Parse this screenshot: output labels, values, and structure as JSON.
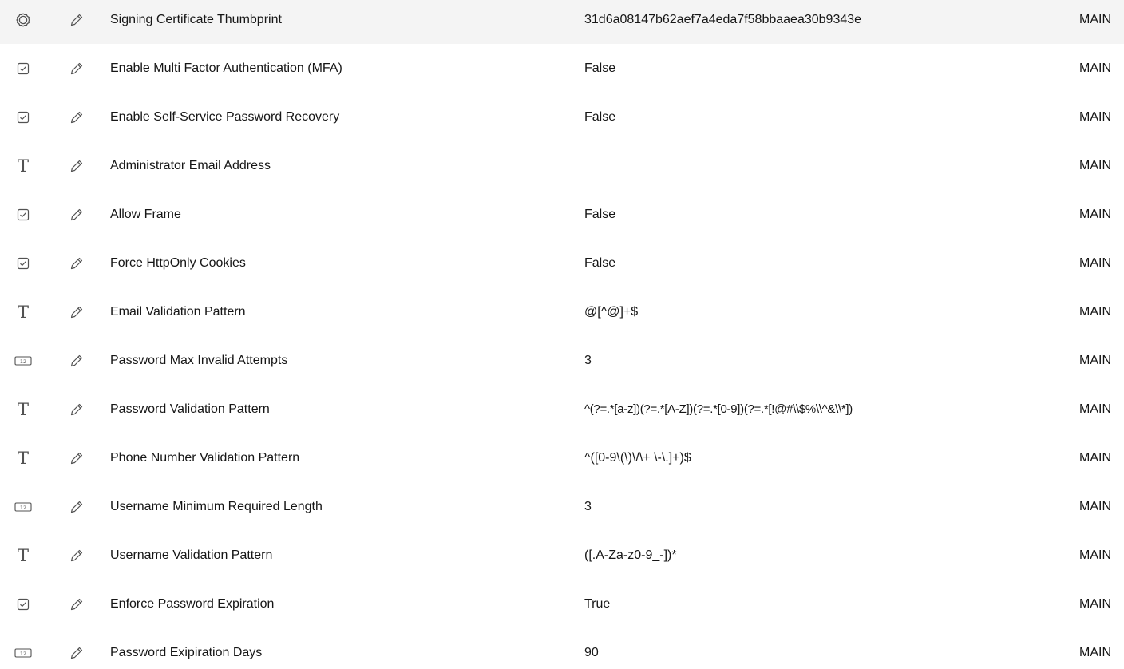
{
  "settings": {
    "rows": [
      {
        "type_icon": "gear-icon",
        "name": "Signing Certificate Thumbprint",
        "value": "31d6a08147b62aef7a4eda7f58bbaaea30b9343e",
        "scope": "MAIN"
      },
      {
        "type_icon": "checkbox-icon",
        "name": "Enable Multi Factor Authentication (MFA)",
        "value": "False",
        "scope": "MAIN"
      },
      {
        "type_icon": "checkbox-icon",
        "name": "Enable Self-Service Password Recovery",
        "value": "False",
        "scope": "MAIN"
      },
      {
        "type_icon": "text-icon",
        "name": "Administrator Email Address",
        "value": "",
        "scope": "MAIN"
      },
      {
        "type_icon": "checkbox-icon",
        "name": "Allow Frame",
        "value": "False",
        "scope": "MAIN"
      },
      {
        "type_icon": "checkbox-icon",
        "name": "Force HttpOnly Cookies",
        "value": "False",
        "scope": "MAIN"
      },
      {
        "type_icon": "text-icon",
        "name": "Email Validation Pattern",
        "value": "@[^@]+$",
        "scope": "MAIN"
      },
      {
        "type_icon": "number-icon",
        "name": "Password Max Invalid Attempts",
        "value": "3",
        "scope": "MAIN"
      },
      {
        "type_icon": "text-icon",
        "name": "Password Validation Pattern",
        "value": "^(?=.*[a-z])(?=.*[A-Z])(?=.*[0-9])(?=.*[!@#\\\\$%\\\\^&\\\\*])",
        "scope": "MAIN"
      },
      {
        "type_icon": "text-icon",
        "name": "Phone Number Validation Pattern",
        "value": "^([0-9\\(\\)\\/\\+ \\-\\.]+)$",
        "scope": "MAIN"
      },
      {
        "type_icon": "number-icon",
        "name": "Username Minimum Required Length",
        "value": "3",
        "scope": "MAIN"
      },
      {
        "type_icon": "text-icon",
        "name": "Username Validation Pattern",
        "value": "([.A-Za-z0-9_-])*",
        "scope": "MAIN"
      },
      {
        "type_icon": "checkbox-icon",
        "name": "Enforce Password Expiration",
        "value": "True",
        "scope": "MAIN"
      },
      {
        "type_icon": "number-icon",
        "name": "Password Exipiration Days",
        "value": "90",
        "scope": "MAIN"
      }
    ],
    "number_icon_label": "12",
    "text_icon_glyph": "T",
    "colors": {
      "text": "#161616",
      "icon": "#525252"
    }
  }
}
